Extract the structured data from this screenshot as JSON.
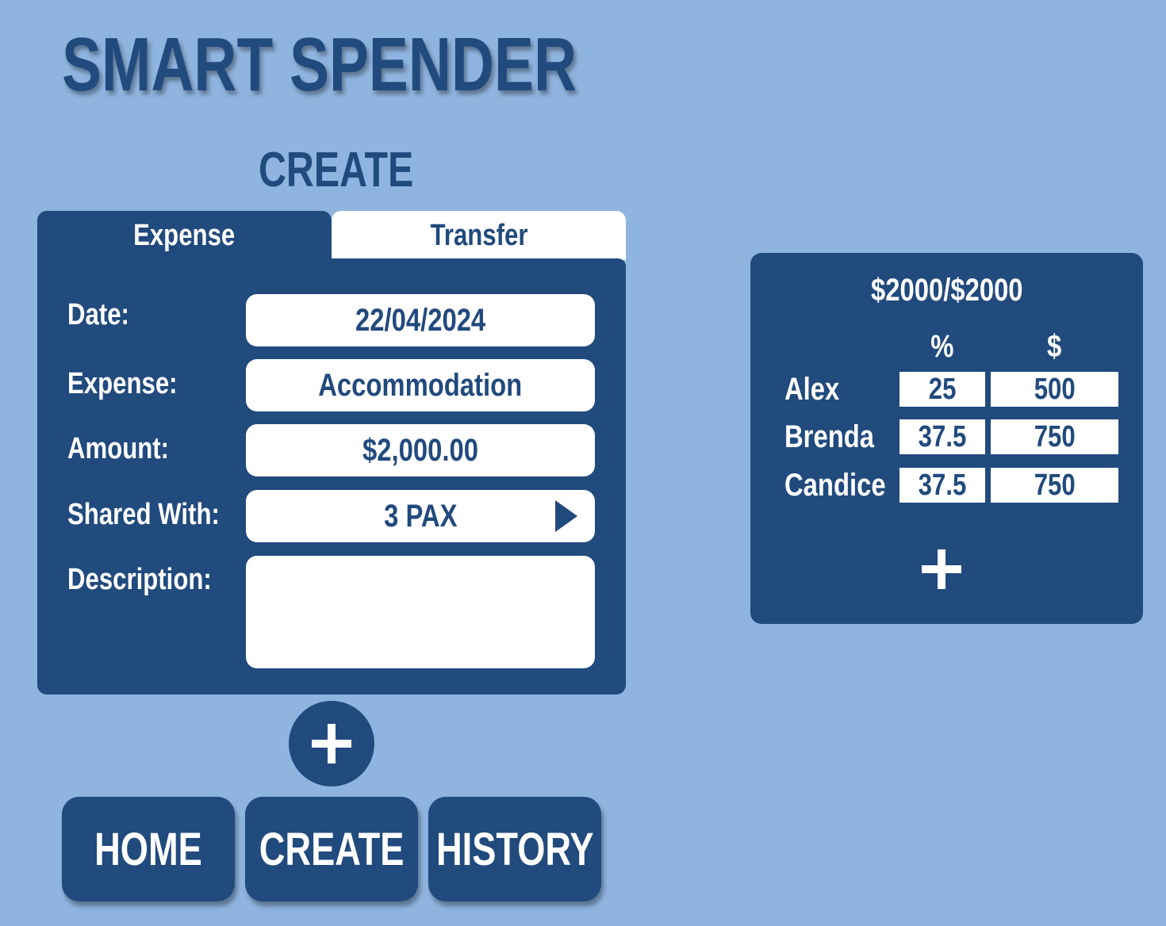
{
  "app": {
    "title": "SMART SPENDER"
  },
  "page": {
    "section_title": "CREATE"
  },
  "tabs": {
    "expense_label": "Expense",
    "transfer_label": "Transfer"
  },
  "form": {
    "date_label": "Date:",
    "date_value": "22/04/2024",
    "expense_label": "Expense:",
    "expense_value": "Accommodation",
    "amount_label": "Amount:",
    "amount_value": "$2,000.00",
    "shared_label": "Shared With:",
    "shared_value": "3 PAX",
    "description_label": "Description:",
    "description_value": ""
  },
  "icons": {
    "add_expense": "plus-icon",
    "shared_chevron": "chevron-right-icon",
    "add_person": "plus-icon"
  },
  "nav": {
    "home_label": "HOME",
    "create_label": "CREATE",
    "history_label": "HISTORY"
  },
  "split": {
    "total": "$2000/$2000",
    "percent_header": "%",
    "amount_header": "$",
    "people": [
      {
        "name": "Alex",
        "percent": "25",
        "amount": "500"
      },
      {
        "name": "Brenda",
        "percent": "37.5",
        "amount": "750"
      },
      {
        "name": "Candice",
        "percent": "37.5",
        "amount": "750"
      }
    ]
  },
  "colors": {
    "background": "#8fb4df",
    "primary": "#214a7d",
    "surface": "#ffffff"
  }
}
